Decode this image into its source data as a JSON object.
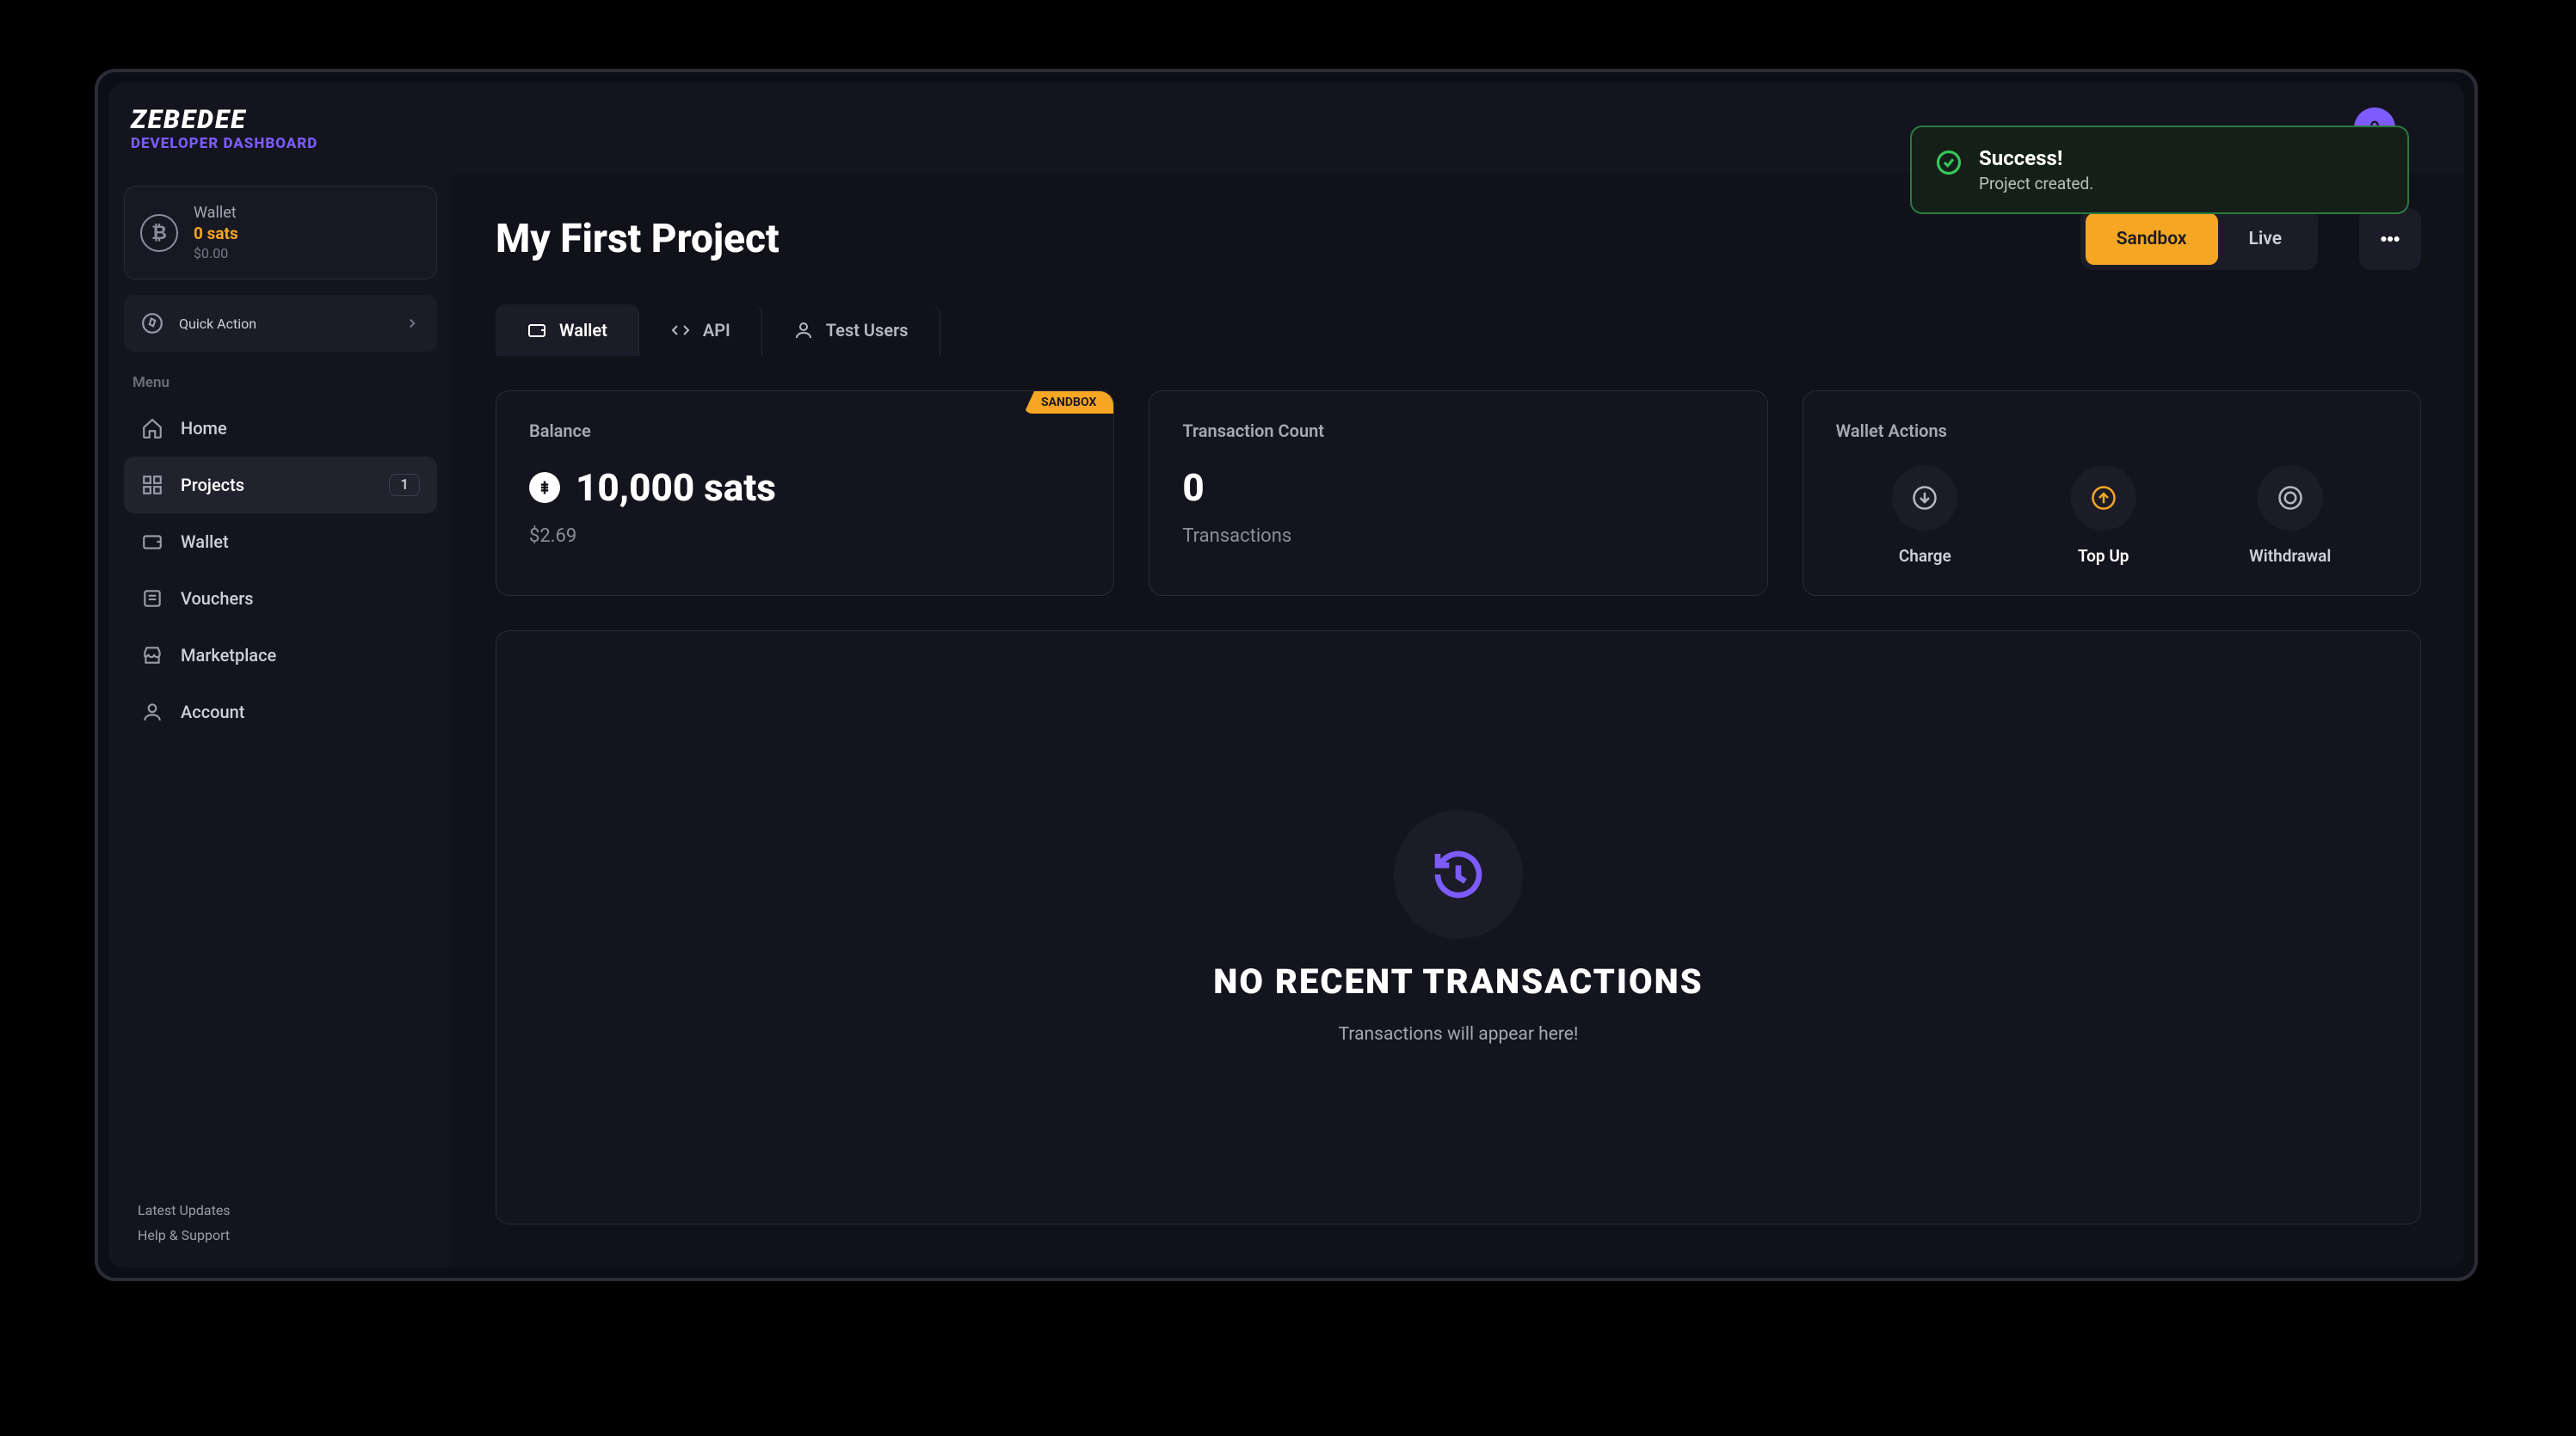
{
  "brand": {
    "logo": "ZEBEDEE",
    "subtitle": "DEVELOPER DASHBOARD"
  },
  "toast": {
    "title": "Success!",
    "message": "Project created."
  },
  "sidebar": {
    "wallet_card": {
      "label": "Wallet",
      "amount": "0 sats",
      "usd": "$0.00"
    },
    "quick_action": "Quick Action",
    "menu_header": "Menu",
    "items": [
      {
        "label": "Home"
      },
      {
        "label": "Projects",
        "badge": "1"
      },
      {
        "label": "Wallet"
      },
      {
        "label": "Vouchers"
      },
      {
        "label": "Marketplace"
      },
      {
        "label": "Account"
      }
    ],
    "footer": {
      "updates": "Latest Updates",
      "help": "Help & Support"
    }
  },
  "page": {
    "title": "My First Project",
    "toggle": {
      "sandbox": "Sandbox",
      "live": "Live"
    },
    "tabs": {
      "wallet": "Wallet",
      "api": "API",
      "test_users": "Test Users"
    },
    "balance_card": {
      "header": "Balance",
      "ribbon": "SANDBOX",
      "amount": "10,000 sats",
      "amount_usd": "$2.69"
    },
    "tx_card": {
      "header": "Transaction Count",
      "count": "0",
      "sub": "Transactions"
    },
    "actions_card": {
      "header": "Wallet Actions",
      "charge": "Charge",
      "topup": "Top Up",
      "withdrawal": "Withdrawal"
    },
    "empty": {
      "title": "NO RECENT TRANSACTIONS",
      "subtitle": "Transactions will appear here!"
    }
  }
}
